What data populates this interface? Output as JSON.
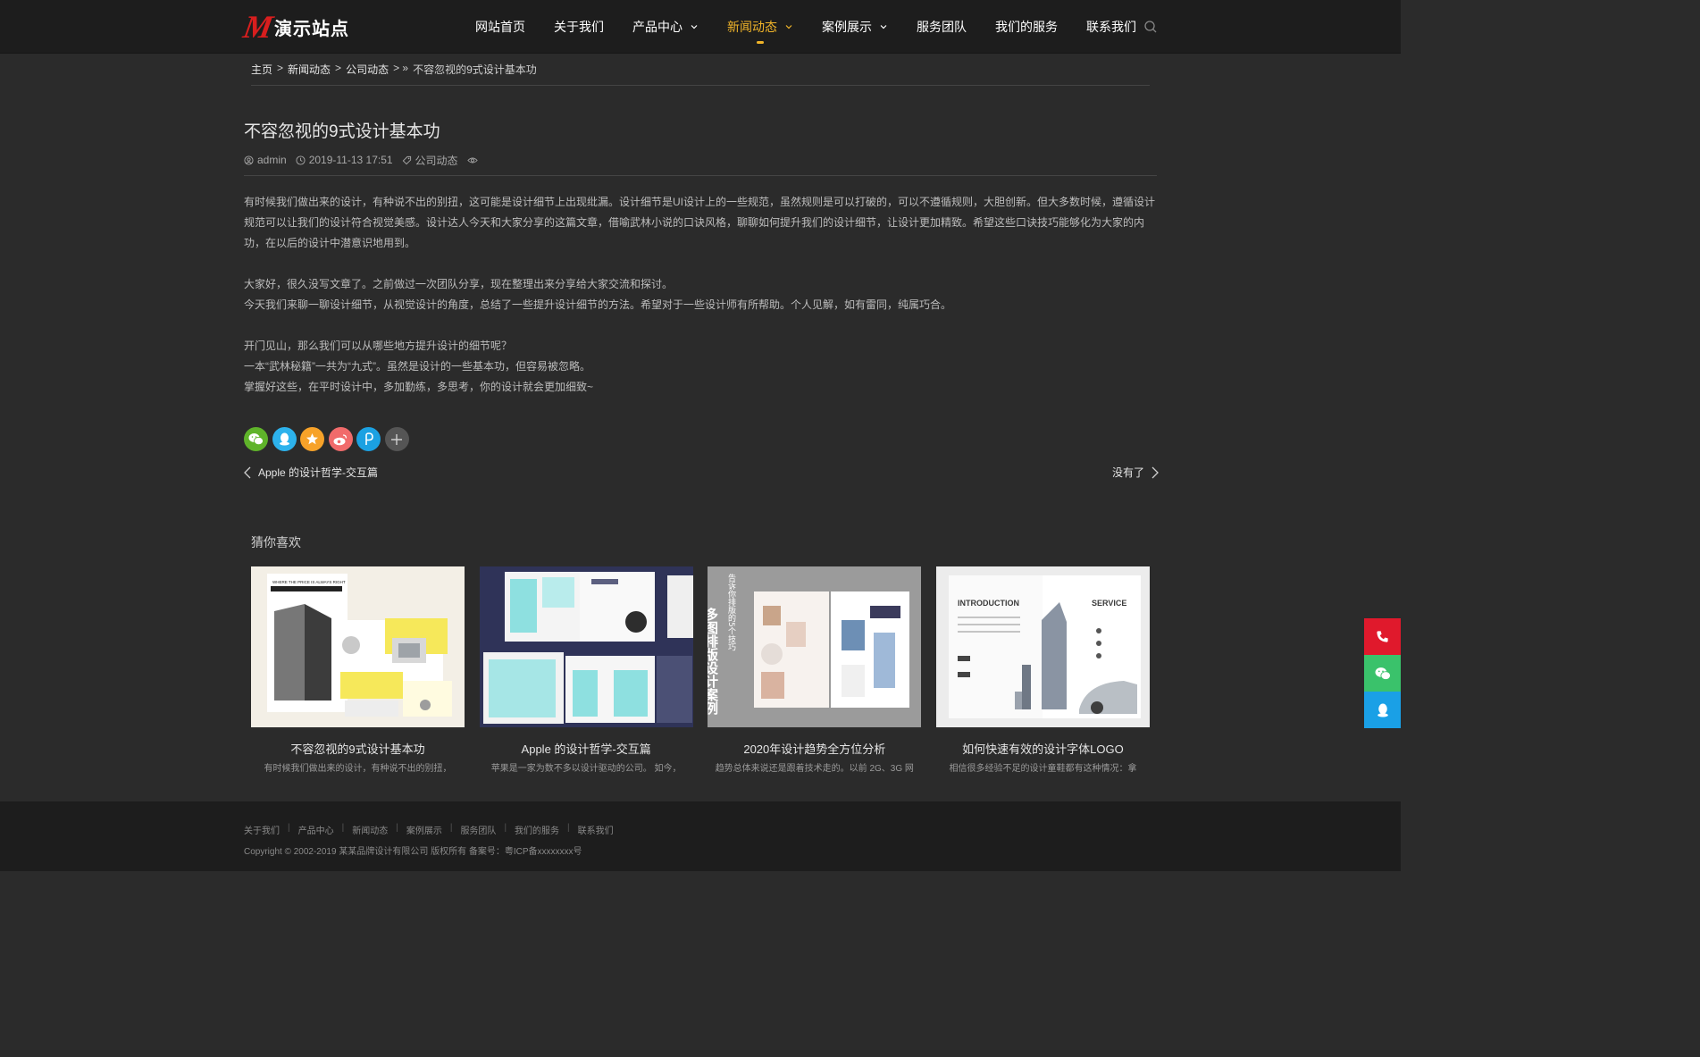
{
  "header": {
    "logo_mark": "M",
    "logo_text": "演示站点",
    "nav": [
      {
        "label": "网站首页"
      },
      {
        "label": "关于我们"
      },
      {
        "label": "产品中心"
      },
      {
        "label": "新闻动态"
      },
      {
        "label": "案例展示"
      },
      {
        "label": "服务团队"
      },
      {
        "label": "我们的服务"
      },
      {
        "label": "联系我们"
      }
    ],
    "accent_color": "#f0b429"
  },
  "breadcrumb": {
    "home": "主页",
    "sep": ">",
    "level1": "新闻动态",
    "level2": "公司动态",
    "tail": "> »",
    "current": "不容忽视的9式设计基本功"
  },
  "article": {
    "title": "不容忽视的9式设计基本功",
    "author": "admin",
    "date": "2019-11-13 17:51",
    "category": "公司动态",
    "paragraphs": [
      "有时候我们做出来的设计，有种说不出的别扭，这可能是设计细节上出现纰漏。设计细节是UI设计上的一些规范，虽然规则是可以打破的，可以不遵循规则，大胆创新。但大多数时候，遵循设计规范可以让我们的设计符合视觉美感。设计达人今天和大家分享的这篇文章，借喻武林小说的口诀风格，聊聊如何提升我们的设计细节，让设计更加精致。希望这些口诀技巧能够化为大家的内功，在以后的设计中潜意识地用到。",
      "大家好，很久没写文章了。之前做过一次团队分享，现在整理出来分享给大家交流和探讨。",
      "今天我们来聊一聊设计细节，从视觉设计的角度，总结了一些提升设计细节的方法。希望对于一些设计师有所帮助。个人见解，如有雷同，纯属巧合。",
      "开门见山，那么我们可以从哪些地方提升设计的细节呢？",
      "一本“武林秘籍”一共为“九式”。虽然是设计的一些基本功，但容易被忽略。",
      "掌握好这些，在平时设计中，多加勤练，多思考，你的设计就会更加细致~"
    ]
  },
  "share": {
    "buttons": [
      "wechat-icon",
      "qq-icon",
      "qzone-icon",
      "weibo-icon",
      "douban-icon",
      "plus-icon"
    ]
  },
  "prev_next": {
    "prev": "Apple 的设计哲学-交互篇",
    "next": "没有了"
  },
  "related": {
    "heading": "猜你喜欢",
    "items": [
      {
        "title": "不容忽视的9式设计基本功",
        "desc": "有时候我们做出来的设计，有种说不出的别扭，"
      },
      {
        "title": "Apple 的设计哲学-交互篇",
        "desc": "苹果是一家为数不多以设计驱动的公司。 如今，"
      },
      {
        "title": "2020年设计趋势全方位分析",
        "desc": "趋势总体来说还是跟着技术走的。以前 2G、3G 网"
      },
      {
        "title": "如何快速有效的设计字体LOGO",
        "desc": "相信很多经验不足的设计童鞋都有这种情况：拿"
      }
    ],
    "thumb_texts": {
      "t1_head": "WHERE THE PRICE IS ALWAYS RIGHT",
      "t3_vertical": "多图排版设计案例",
      "t3_vertical2": "告诉你排版的5个技巧",
      "t4_left": "INTRODUCTION",
      "t4_right": "SERVICE"
    }
  },
  "footer": {
    "links": [
      "关于我们",
      "产品中心",
      "新闻动态",
      "案例展示",
      "服务团队",
      "我们的服务",
      "联系我们"
    ],
    "copyright": "Copyright © 2002-2019 某某品牌设计有限公司 版权所有 备案号：粤ICP备xxxxxxxx号"
  },
  "float_bar": [
    "phone-icon",
    "wechat-icon",
    "qq-icon"
  ]
}
